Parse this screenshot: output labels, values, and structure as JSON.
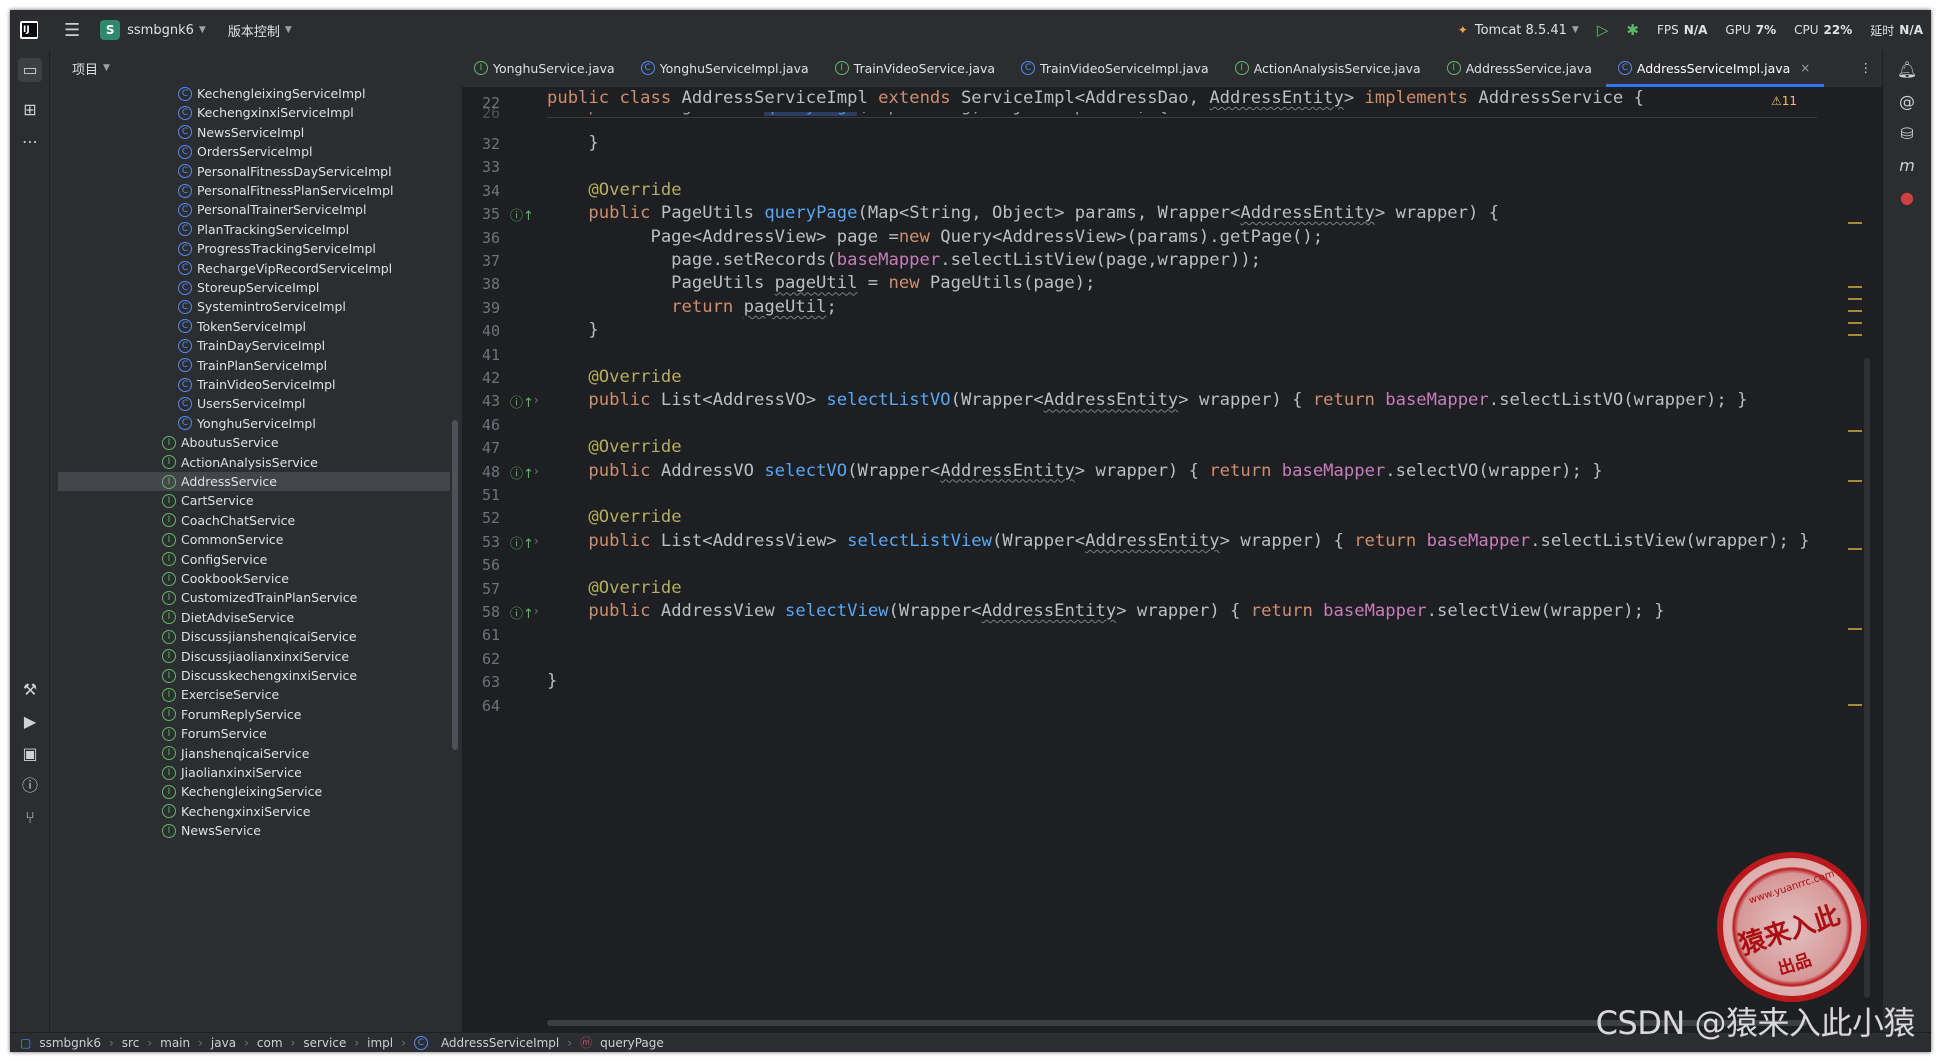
{
  "titlebar": {
    "project_badge": "S",
    "project_name": "ssmbgnk6",
    "vcs": "版本控制",
    "run_config": "Tomcat 8.5.41",
    "fps_label": "FPS",
    "fps_value": "N/A",
    "gpu_label": "GPU",
    "gpu_value": "7%",
    "cpu_label": "CPU",
    "cpu_value": "22%",
    "time_label": "延时",
    "time_value": "N/A"
  },
  "project_panel": {
    "title": "项目",
    "selected_index": 20,
    "items": [
      {
        "name": "KechengleixingServiceImpl",
        "kind": "class"
      },
      {
        "name": "KechengxinxiServiceImpl",
        "kind": "class"
      },
      {
        "name": "NewsServiceImpl",
        "kind": "class"
      },
      {
        "name": "OrdersServiceImpl",
        "kind": "class"
      },
      {
        "name": "PersonalFitnessDayServiceImpl",
        "kind": "class"
      },
      {
        "name": "PersonalFitnessPlanServiceImpl",
        "kind": "class"
      },
      {
        "name": "PersonalTrainerServiceImpl",
        "kind": "class"
      },
      {
        "name": "PlanTrackingServiceImpl",
        "kind": "class"
      },
      {
        "name": "ProgressTrackingServiceImpl",
        "kind": "class"
      },
      {
        "name": "RechargeVipRecordServiceImpl",
        "kind": "class"
      },
      {
        "name": "StoreupServiceImpl",
        "kind": "class"
      },
      {
        "name": "SystemintroServiceImpl",
        "kind": "class"
      },
      {
        "name": "TokenServiceImpl",
        "kind": "class"
      },
      {
        "name": "TrainDayServiceImpl",
        "kind": "class"
      },
      {
        "name": "TrainPlanServiceImpl",
        "kind": "class"
      },
      {
        "name": "TrainVideoServiceImpl",
        "kind": "class"
      },
      {
        "name": "UsersServiceImpl",
        "kind": "class"
      },
      {
        "name": "YonghuServiceImpl",
        "kind": "class"
      },
      {
        "name": "AboutusService",
        "kind": "interface"
      },
      {
        "name": "ActionAnalysisService",
        "kind": "interface"
      },
      {
        "name": "AddressService",
        "kind": "interface"
      },
      {
        "name": "CartService",
        "kind": "interface"
      },
      {
        "name": "CoachChatService",
        "kind": "interface"
      },
      {
        "name": "CommonService",
        "kind": "interface"
      },
      {
        "name": "ConfigService",
        "kind": "interface"
      },
      {
        "name": "CookbookService",
        "kind": "interface"
      },
      {
        "name": "CustomizedTrainPlanService",
        "kind": "interface"
      },
      {
        "name": "DietAdviseService",
        "kind": "interface"
      },
      {
        "name": "DiscussjianshenqicaiService",
        "kind": "interface"
      },
      {
        "name": "DiscussjiaolianxinxiService",
        "kind": "interface"
      },
      {
        "name": "DiscusskechengxinxiService",
        "kind": "interface"
      },
      {
        "name": "ExerciseService",
        "kind": "interface"
      },
      {
        "name": "ForumReplyService",
        "kind": "interface"
      },
      {
        "name": "ForumService",
        "kind": "interface"
      },
      {
        "name": "JianshenqicaiService",
        "kind": "interface"
      },
      {
        "name": "JiaolianxinxiService",
        "kind": "interface"
      },
      {
        "name": "KechengleixingService",
        "kind": "interface"
      },
      {
        "name": "KechengxinxiService",
        "kind": "interface"
      },
      {
        "name": "NewsService",
        "kind": "interface"
      }
    ]
  },
  "tabs": [
    {
      "label": "YonghuService.java",
      "kind": "interface",
      "active": false
    },
    {
      "label": "YonghuServiceImpl.java",
      "kind": "class",
      "active": false
    },
    {
      "label": "TrainVideoService.java",
      "kind": "interface",
      "active": false
    },
    {
      "label": "TrainVideoServiceImpl.java",
      "kind": "class",
      "active": false
    },
    {
      "label": "ActionAnalysisService.java",
      "kind": "interface",
      "active": false
    },
    {
      "label": "AddressService.java",
      "kind": "interface",
      "active": false
    },
    {
      "label": "AddressServiceImpl.java",
      "kind": "class",
      "active": true
    }
  ],
  "editor": {
    "warnings": "⚠11",
    "sticky_line_number": "22",
    "sticky_line": "public class AddressServiceImpl extends ServiceImpl<AddressDao, AddressEntity> implements AddressService {",
    "peek_line_number": "26",
    "peek_line": "    public PageUtils queryPage(Map<String, Object> params) {",
    "line_numbers": [
      "32",
      "33",
      "34",
      "35",
      "36",
      "37",
      "38",
      "39",
      "40",
      "41",
      "42",
      "43",
      "46",
      "47",
      "48",
      "51",
      "52",
      "53",
      "56",
      "57",
      "58",
      "61",
      "62",
      "63",
      "64"
    ],
    "override_lines": [
      "35",
      "43",
      "48",
      "53",
      "58"
    ],
    "code_lines": [
      "    }",
      "",
      "    @Override",
      "    public PageUtils queryPage(Map<String, Object> params, Wrapper<AddressEntity> wrapper) {",
      "          Page<AddressView> page =new Query<AddressView>(params).getPage();",
      "            page.setRecords(baseMapper.selectListView(page,wrapper));",
      "            PageUtils pageUtil = new PageUtils(page);",
      "            return pageUtil;",
      "    }",
      "",
      "    @Override",
      "    public List<AddressVO> selectListVO(Wrapper<AddressEntity> wrapper) { return baseMapper.selectListVO(wrapper); }",
      "",
      "    @Override",
      "    public AddressVO selectVO(Wrapper<AddressEntity> wrapper) { return baseMapper.selectVO(wrapper); }",
      "",
      "    @Override",
      "    public List<AddressView> selectListView(Wrapper<AddressEntity> wrapper) { return baseMapper.selectListView(wrapper); }",
      "",
      "    @Override",
      "    public AddressView selectView(Wrapper<AddressEntity> wrapper) { return baseMapper.selectView(wrapper); }",
      "",
      "",
      "}",
      ""
    ]
  },
  "breadcrumb": [
    "ssmbgnk6",
    "src",
    "main",
    "java",
    "com",
    "service",
    "impl",
    "AddressServiceImpl",
    "queryPage"
  ],
  "watermark": {
    "csdn": "CSDN @猿来入此小猿",
    "stamp_main": "猿来入此",
    "stamp_sub": "出品",
    "stamp_url": "www.yuanrrc.com"
  },
  "colors": {
    "background": "#1e1f22",
    "panel": "#2b2d30",
    "keyword": "#cf8e6d",
    "annotation": "#b3ae60",
    "method": "#56a8f5",
    "field": "#c77dbb",
    "accent": "#3574f0"
  }
}
